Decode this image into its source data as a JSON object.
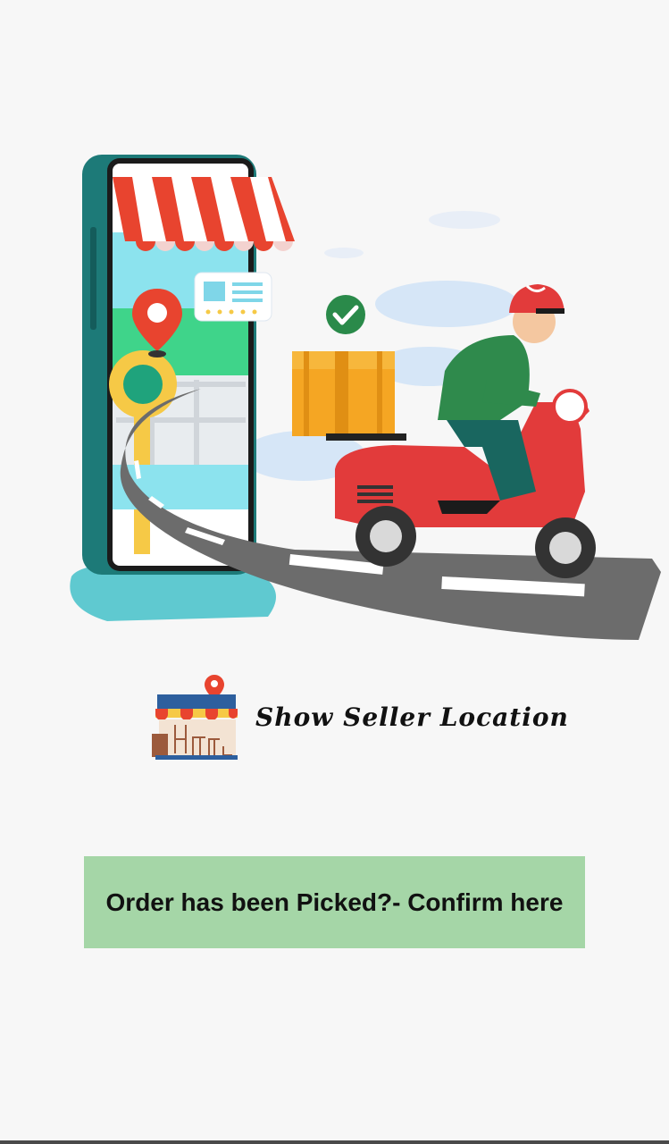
{
  "hero": {
    "illustration": "delivery-scooter-illustration"
  },
  "seller_location": {
    "label": "Show Seller Location",
    "icon": "store-with-pin-icon"
  },
  "confirm": {
    "label": "Order has been Picked?- Confirm here",
    "bg_color": "#a5d6a7"
  }
}
